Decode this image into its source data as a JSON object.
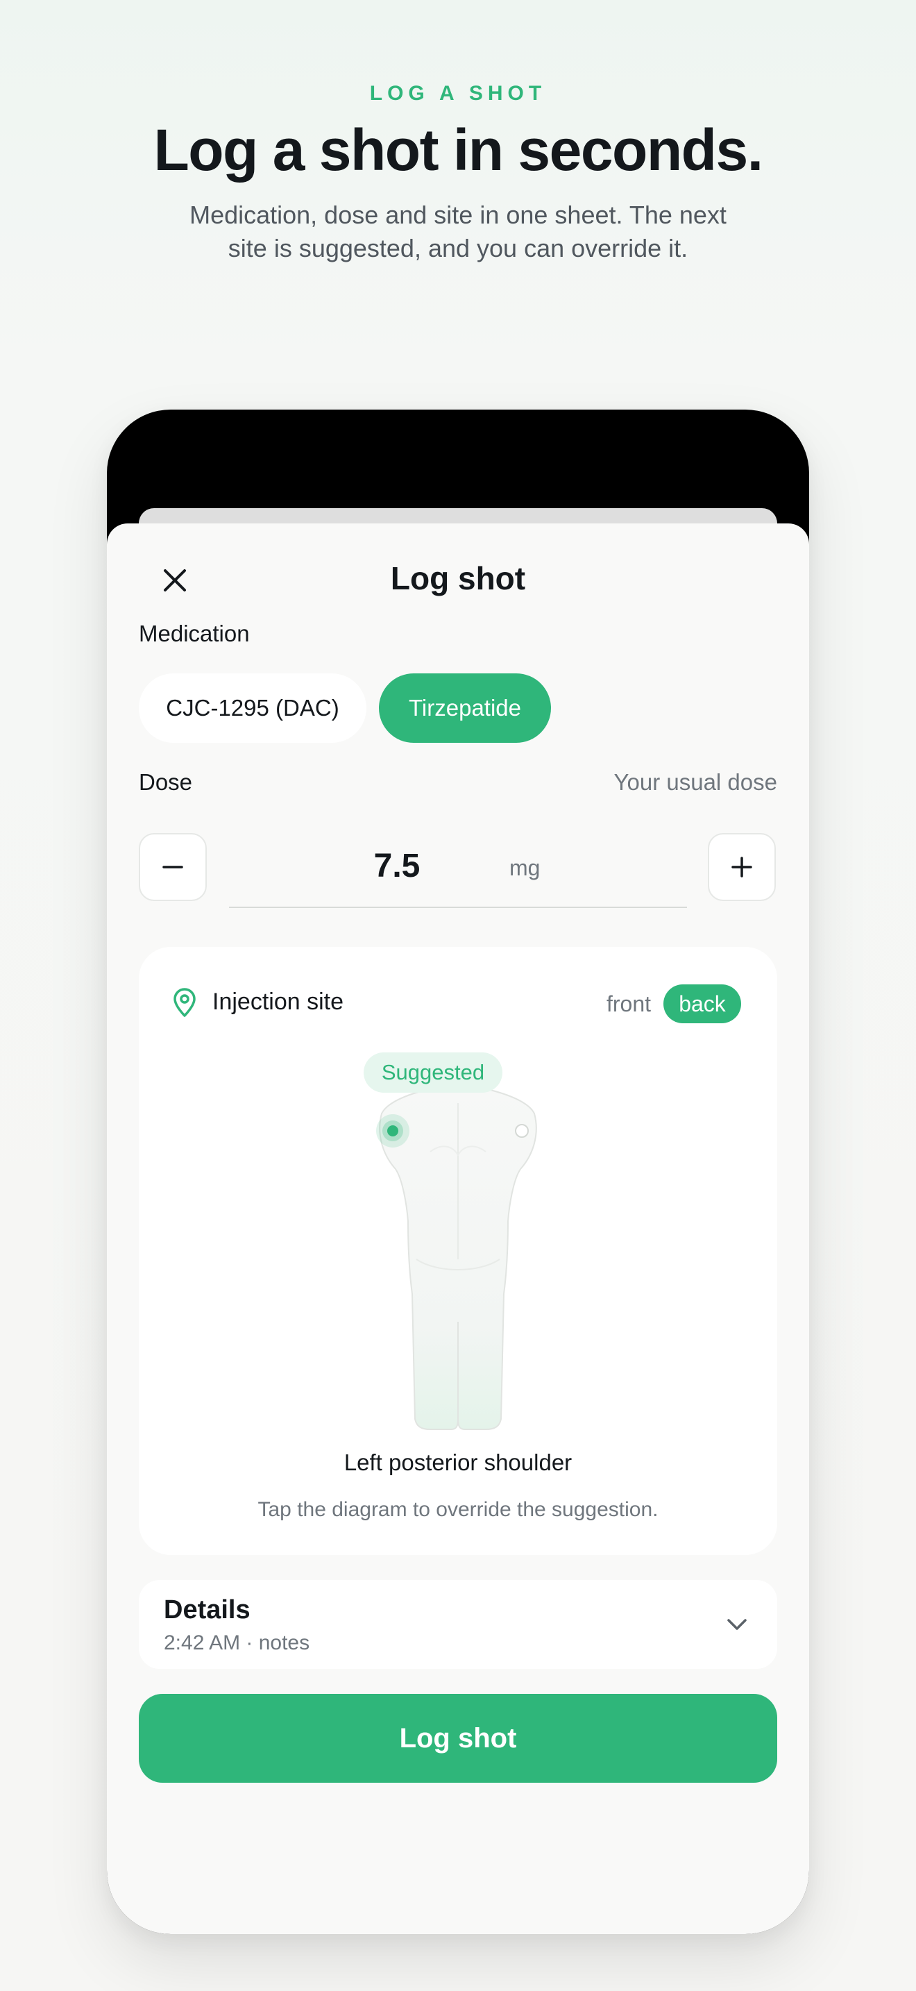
{
  "hero": {
    "eyebrow": "LOG A SHOT",
    "headline": "Log a shot in seconds.",
    "subcopy": "Medication, dose and site in one sheet. The next site is suggested, and you can override it."
  },
  "sheet": {
    "title": "Log shot",
    "close_icon": "close-icon"
  },
  "medication": {
    "label": "Medication",
    "options": [
      {
        "label": "CJC-1295 (DAC)",
        "selected": false
      },
      {
        "label": "Tirzepatide",
        "selected": true
      }
    ]
  },
  "dose": {
    "label": "Dose",
    "hint": "Your usual dose",
    "value": "7.5",
    "unit": "mg",
    "decrement_label": "–",
    "increment_label": "+"
  },
  "injection_site": {
    "label": "Injection site",
    "icon": "map-pin-icon",
    "views": [
      {
        "label": "front",
        "selected": false
      },
      {
        "label": "back",
        "selected": true
      }
    ],
    "suggested_badge": "Suggested",
    "selected_site": "Left posterior shoulder",
    "hint": "Tap the diagram to override the suggestion."
  },
  "details": {
    "title": "Details",
    "subtitle": "2:42 AM · notes",
    "icon": "chevron-down-icon"
  },
  "primary_action": {
    "label": "Log shot"
  },
  "colors": {
    "accent": "#2fb67a",
    "accent_soft": "#e6f6ee",
    "text": "#14181c",
    "muted": "#6f767d"
  }
}
